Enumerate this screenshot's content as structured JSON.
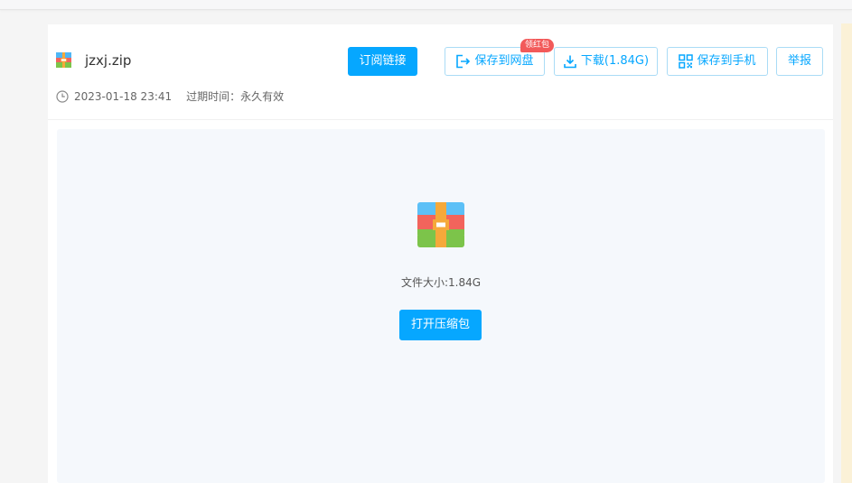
{
  "file": {
    "name": "jzxj.zip",
    "date": "2023-01-18 23:41",
    "expiry": "过期时间：永久有效"
  },
  "actions": {
    "subscribe": "订阅链接",
    "save_cloud": "保存到网盘",
    "save_cloud_badge": "领红包",
    "download": "下载(1.84G)",
    "save_phone": "保存到手机",
    "report": "举报"
  },
  "preview": {
    "size_text": "文件大小:1.84G",
    "open_button": "打开压缩包"
  },
  "colors": {
    "accent": "#06a7ff",
    "badge": "#f25a5a"
  }
}
